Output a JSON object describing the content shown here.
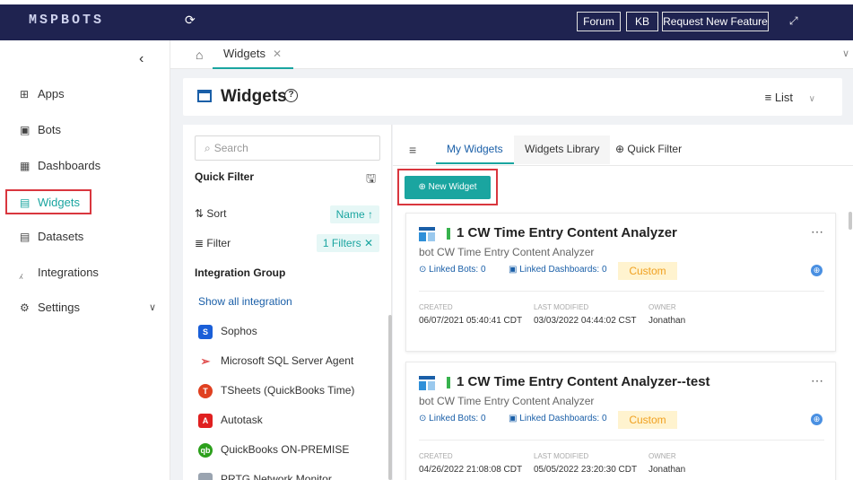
{
  "app": {
    "logo_text": "MSPBOTS"
  },
  "topbar": {
    "forum": "Forum",
    "kb": "KB",
    "request": "Request New Feature"
  },
  "sidebar": {
    "items": [
      {
        "label": "Apps",
        "icon": "grid-icon"
      },
      {
        "label": "Bots",
        "icon": "robot-icon"
      },
      {
        "label": "Dashboards",
        "icon": "table-icon"
      },
      {
        "label": "Widgets",
        "icon": "widget-icon"
      },
      {
        "label": "Datasets",
        "icon": "dataset-icon"
      },
      {
        "label": "Integrations",
        "icon": "plug-icon"
      },
      {
        "label": "Settings",
        "icon": "gear-icon"
      }
    ],
    "active": "Widgets"
  },
  "tabs": {
    "current": "Widgets"
  },
  "header": {
    "title": "Widgets",
    "view": "List"
  },
  "filter": {
    "search_placeholder": "Search",
    "quick_filter": "Quick Filter",
    "sort_label": "Sort",
    "sort_value": "Name",
    "filter_label": "Filter",
    "filter_value": "1 Filters",
    "integration_group": "Integration Group",
    "show_all": "Show all integration",
    "integrations": [
      {
        "name": "Sophos",
        "color": "#1a5fd8",
        "glyph": "S"
      },
      {
        "name": "Microsoft SQL Server Agent",
        "color": "#e05050",
        "glyph": ""
      },
      {
        "name": "TSheets (QuickBooks Time)",
        "color": "#e04020",
        "glyph": "T"
      },
      {
        "name": "Autotask",
        "color": "#e02020",
        "glyph": "A"
      },
      {
        "name": "QuickBooks ON-PREMISE",
        "color": "#2ca01c",
        "glyph": "qb"
      },
      {
        "name": "PRTG Network Monitor",
        "color": "#9aa4b0",
        "glyph": ""
      }
    ]
  },
  "main": {
    "tabs": [
      "My Widgets",
      "Widgets Library",
      "Quick Filter"
    ],
    "new_widget": "New Widget",
    "cards": [
      {
        "title": "1 CW Time Entry Content Analyzer",
        "subtitle": "bot CW Time Entry Content Analyzer",
        "linked_bots": "Linked Bots: 0",
        "linked_dashboards": "Linked Dashboards: 0",
        "tag": "Custom",
        "created_label": "CREATED",
        "created": "06/07/2021 05:40:41 CDT",
        "modified_label": "LAST MODIFIED",
        "modified": "03/03/2022 04:44:02 CST",
        "owner_label": "OWNER",
        "owner": "Jonathan"
      },
      {
        "title": "1 CW Time Entry Content Analyzer--test",
        "subtitle": "bot CW Time Entry Content Analyzer",
        "linked_bots": "Linked Bots: 0",
        "linked_dashboards": "Linked Dashboards: 0",
        "tag": "Custom",
        "created_label": "CREATED",
        "created": "04/26/2022 21:08:08 CDT",
        "modified_label": "LAST MODIFIED",
        "modified": "05/05/2022 23:20:30 CDT",
        "owner_label": "OWNER",
        "owner": "Jonathan"
      }
    ]
  }
}
